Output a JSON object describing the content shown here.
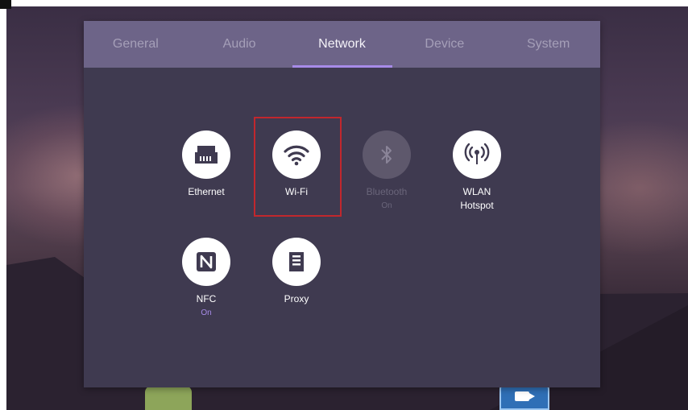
{
  "tabs": [
    {
      "label": "General",
      "active": false
    },
    {
      "label": "Audio",
      "active": false
    },
    {
      "label": "Network",
      "active": true
    },
    {
      "label": "Device",
      "active": false
    },
    {
      "label": "System",
      "active": false
    }
  ],
  "items": [
    {
      "label": "Ethernet",
      "icon": "ethernet-icon",
      "status": ""
    },
    {
      "label": "Wi-Fi",
      "icon": "wifi-icon",
      "status": "",
      "selected": true
    },
    {
      "label": "Bluetooth",
      "icon": "bluetooth-icon",
      "status": "On",
      "disabled": true
    },
    {
      "label": "WLAN\nHotspot",
      "icon": "hotspot-icon",
      "status": ""
    },
    {
      "label": "NFC",
      "icon": "nfc-icon",
      "status": "On"
    },
    {
      "label": "Proxy",
      "icon": "proxy-icon",
      "status": ""
    }
  ],
  "colors": {
    "tab_bar": "#6d6488",
    "panel": "#3f3a50",
    "accent": "#a78be8",
    "highlight": "#c1272d"
  }
}
